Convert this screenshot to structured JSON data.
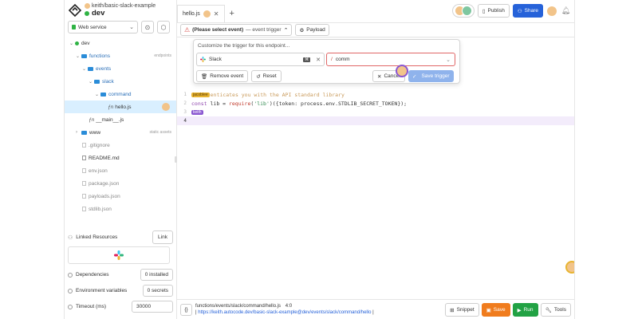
{
  "sidebar": {
    "user_path": "keith/basic-slack-example",
    "env": "dev",
    "service_select": "Web service",
    "tree": [
      {
        "label": "dev"
      },
      {
        "label": "functions",
        "hint": "endpoints"
      },
      {
        "label": "events"
      },
      {
        "label": "slack"
      },
      {
        "label": "command"
      },
      {
        "label": "hello.js",
        "prefix": "ƒn"
      },
      {
        "label": "__main__.js",
        "prefix": "ƒn"
      },
      {
        "label": "www",
        "hint": "static assets"
      },
      {
        "label": ".gitignore"
      },
      {
        "label": "README.md"
      },
      {
        "label": "env.json"
      },
      {
        "label": "package.json"
      },
      {
        "label": "payloads.json"
      },
      {
        "label": "stdlib.json"
      }
    ],
    "linked_resources_label": "Linked Resources",
    "link_button": "Link",
    "dependencies_label": "Dependencies",
    "dependencies_value": "0 installed",
    "env_vars_label": "Environment variables",
    "env_vars_value": "0 secrets",
    "timeout_label": "Timeout (ms)",
    "timeout_value": "30000"
  },
  "tabs": [
    {
      "label": "hello.js"
    }
  ],
  "header": {
    "publish": "Publish",
    "share": "Share"
  },
  "toolbar": {
    "trigger_warning": "(Please select event)",
    "trigger_suffix": "— event trigger",
    "payload": "Payload"
  },
  "popup": {
    "title": "Customize the trigger for this endpoint...",
    "event_value": "Slack",
    "event_kbd": "⌘",
    "command_prefix": "/",
    "command_value": "comm",
    "remove_event": "Remove event",
    "reset": "Reset",
    "cancel": "Cancel",
    "save_trigger": "Save trigger"
  },
  "editor": {
    "lines": [
      {
        "no": "1",
        "tag": "jacoblee",
        "text": "enticates you with the API standard library"
      },
      {
        "no": "2",
        "code_kw": "const",
        "code_mid": " lib = ",
        "code_fn": "require",
        "code_paren": "(",
        "code_str": "'lib'",
        "code_rest": ")({token: process.env.STDLIB_SECRET_TOKEN});"
      },
      {
        "no": "3",
        "tag": "keith"
      },
      {
        "no": "4"
      }
    ]
  },
  "status": {
    "path": "functions/events/slack/command/hello.js",
    "position": "4:0",
    "url": "https://keith.autocode.dev/basic-slack-example@dev/events/slack/command/hello",
    "snippet": "Snippet",
    "save": "Save",
    "run": "Run",
    "tools": "Tools"
  },
  "colors": {
    "accent": "#2662d9",
    "save": "#f07c1d",
    "run": "#22a244",
    "env_dot": "#2fb344",
    "cursor_ring": "#8a57d1"
  }
}
